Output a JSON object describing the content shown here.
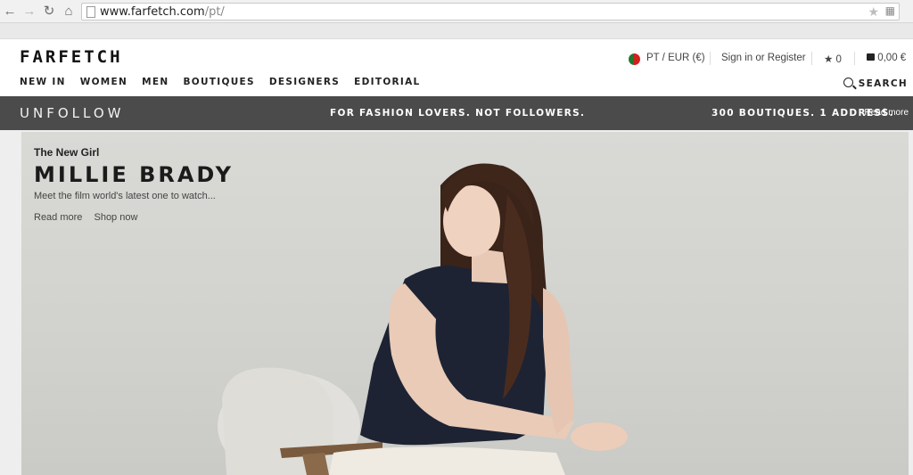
{
  "browser": {
    "url_host": "www.farfetch.com",
    "url_path": "/pt/"
  },
  "header": {
    "logo": "FARFETCH",
    "nav": [
      "NEW IN",
      "WOMEN",
      "MEN",
      "BOUTIQUES",
      "DESIGNERS",
      "EDITORIAL"
    ],
    "locale": "PT / EUR (€)",
    "sign_in": "Sign in or Register",
    "wishlist_count": "0",
    "bag_total": "0,00 €",
    "search_label": "SEARCH"
  },
  "promo": {
    "logo": "UNFOLLOW",
    "tagline": "FOR FASHION LOVERS. NOT FOLLOWERS.",
    "boutiques": "300 BOUTIQUES. 1 ADDRESS.",
    "read_more": "Read more"
  },
  "hero": {
    "eyebrow": "The New Girl",
    "title": "MILLIE BRADY",
    "subtitle": "Meet the film world's latest one to watch...",
    "link_read": "Read more",
    "link_shop": "Shop now"
  }
}
